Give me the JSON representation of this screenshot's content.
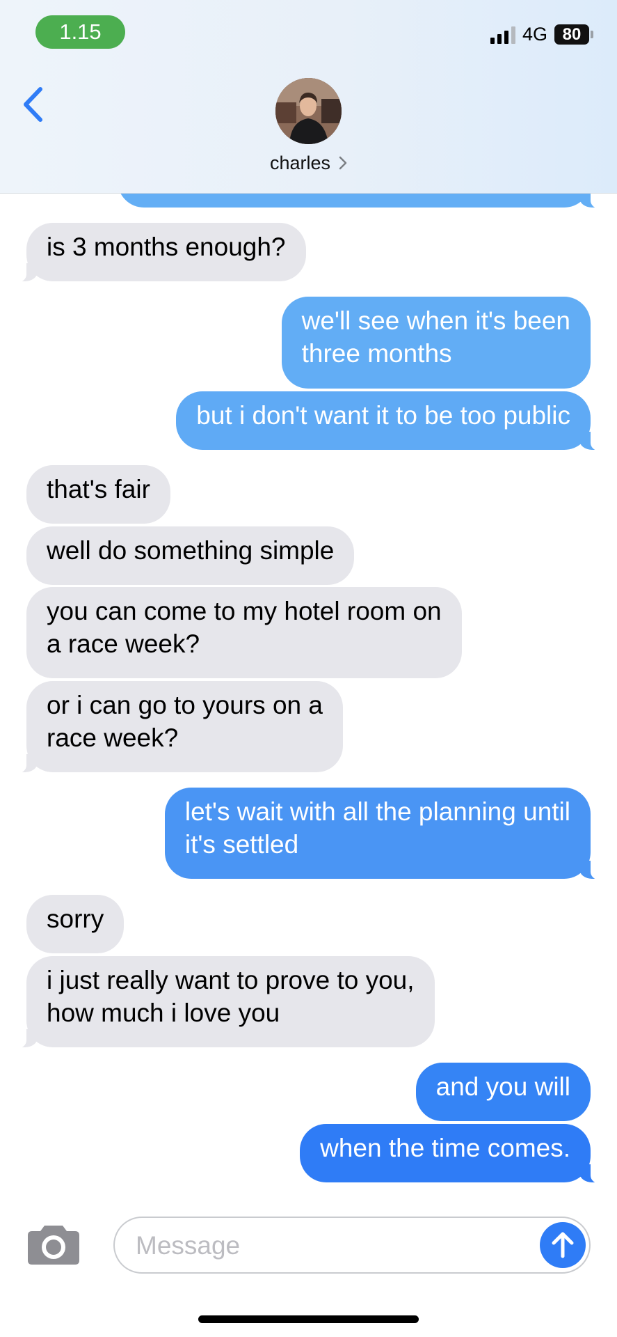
{
  "status_bar": {
    "time": "1.15",
    "network": "4G",
    "battery": "80"
  },
  "header": {
    "contact_name": "charles",
    "back_icon": "chevron-left-icon",
    "chevron_icon": "chevron-right-icon"
  },
  "messages": [
    {
      "direction": "out",
      "text": "",
      "partial": true
    },
    {
      "direction": "in",
      "lines": [
        "is 3 months enough?"
      ]
    },
    {
      "direction": "out",
      "lines": [
        "we'll see when it's been",
        "three months"
      ]
    },
    {
      "direction": "out",
      "lines": [
        "but i don't want it to be too public"
      ]
    },
    {
      "direction": "in",
      "lines": [
        "that's fair"
      ]
    },
    {
      "direction": "in",
      "lines": [
        "well do something simple"
      ]
    },
    {
      "direction": "in",
      "lines": [
        "you can come to my hotel room on",
        "a race week?"
      ]
    },
    {
      "direction": "in",
      "lines": [
        "or i can go to yours on a",
        "race week?"
      ]
    },
    {
      "direction": "out",
      "lines": [
        "let's wait with all the planning until",
        "it's settled"
      ]
    },
    {
      "direction": "in",
      "lines": [
        "sorry"
      ]
    },
    {
      "direction": "in",
      "lines": [
        "i just really want to prove to you,",
        "how much i love you"
      ]
    },
    {
      "direction": "out",
      "lines": [
        "and you will"
      ]
    },
    {
      "direction": "out",
      "lines": [
        "when the time comes."
      ]
    }
  ],
  "composer": {
    "placeholder": "Message",
    "value": "",
    "camera_icon": "camera-icon",
    "send_icon": "arrow-up-icon"
  },
  "colors": {
    "incoming_bubble": "#e6e6eb",
    "outgoing_top": "#66b0f5",
    "outgoing_bottom": "#2f7cf6",
    "time_pill": "#4cae50",
    "accent": "#2f7cf6"
  }
}
